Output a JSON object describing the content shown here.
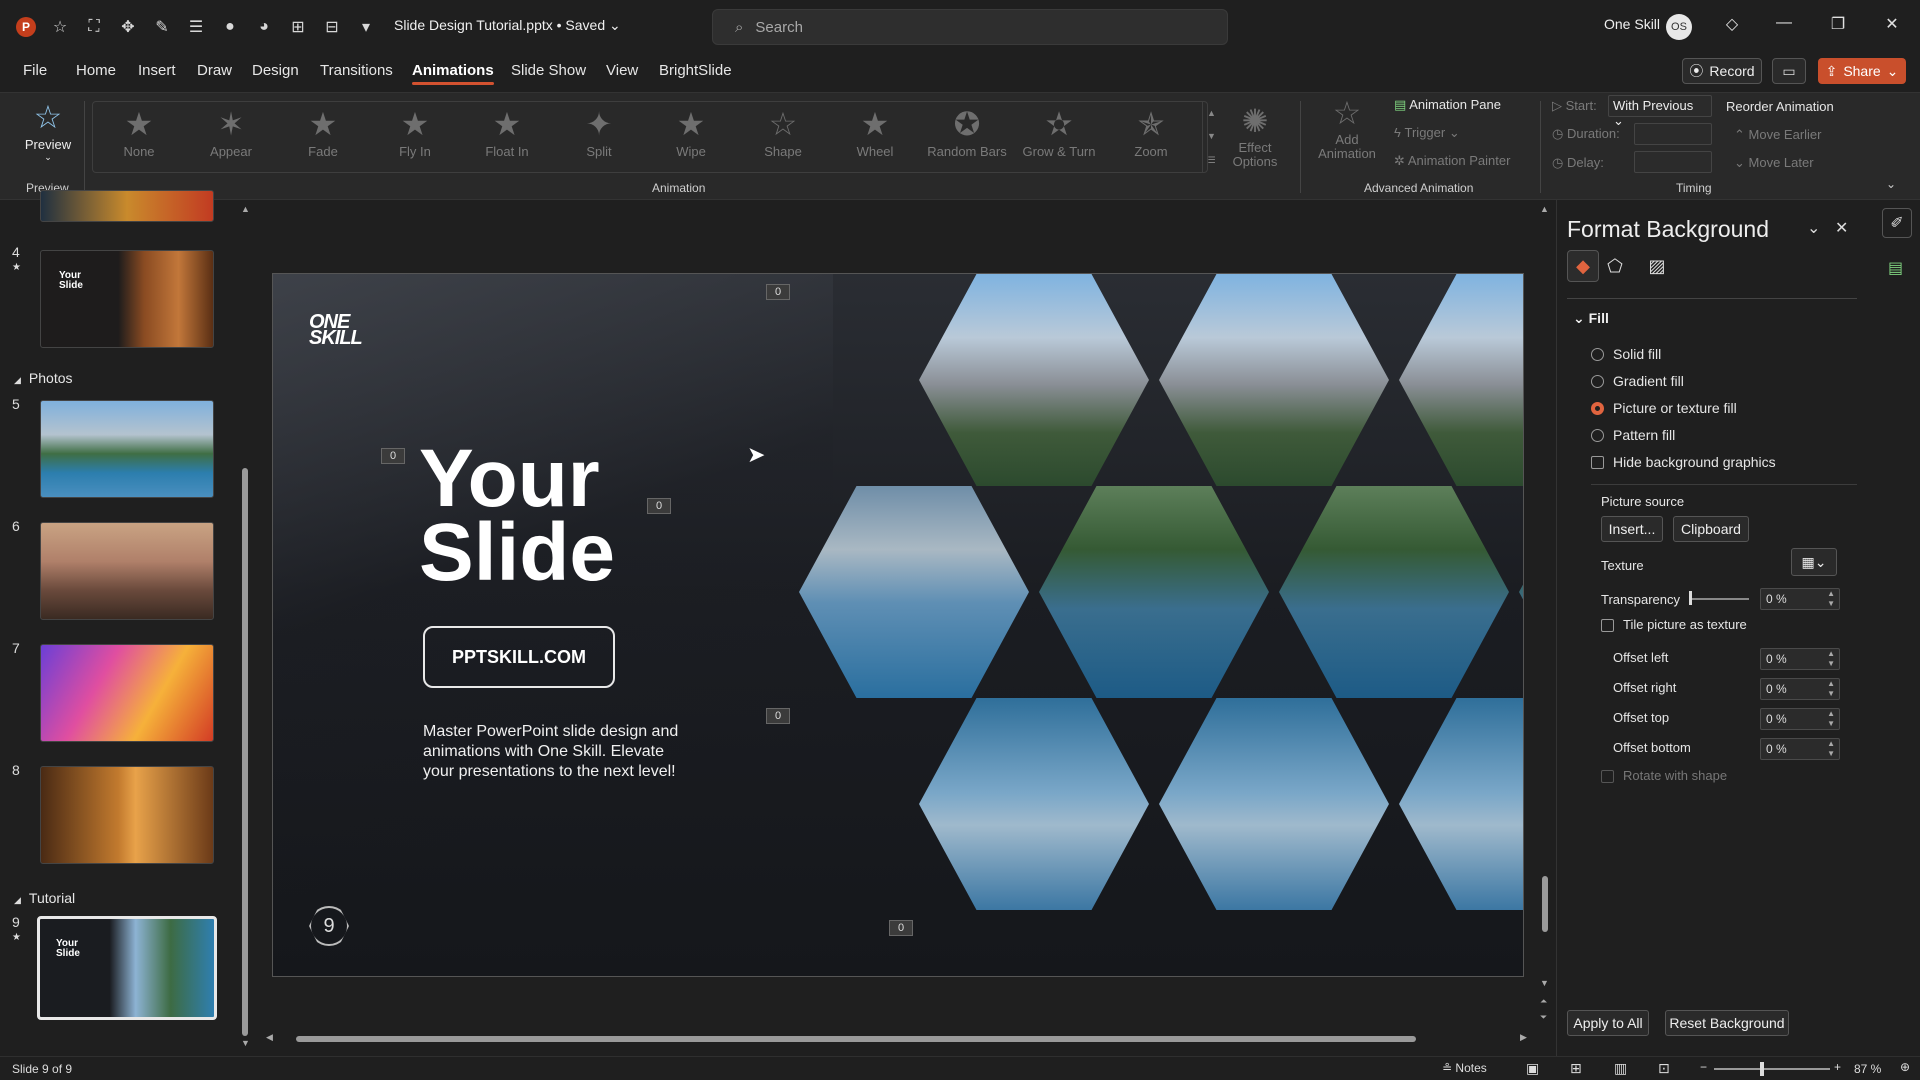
{
  "titlebar": {
    "doc_title": "Slide Design Tutorial.pptx • Saved",
    "search_placeholder": "Search",
    "user_name": "One Skill",
    "avatar_initials": "OS"
  },
  "tabs": [
    "File",
    "Home",
    "Insert",
    "Draw",
    "Design",
    "Transitions",
    "Animations",
    "Slide Show",
    "View",
    "BrightSlide"
  ],
  "active_tab": "Animations",
  "actions": {
    "record": "Record",
    "share": "Share"
  },
  "ribbon": {
    "preview": {
      "label": "Preview",
      "group": "Preview"
    },
    "animation_group": "Animation",
    "animations": [
      "None",
      "Appear",
      "Fade",
      "Fly In",
      "Float In",
      "Split",
      "Wipe",
      "Shape",
      "Wheel",
      "Random Bars",
      "Grow & Turn",
      "Zoom"
    ],
    "effect_options": [
      "Effect",
      "Options"
    ],
    "add_animation": [
      "Add",
      "Animation"
    ],
    "advanced": {
      "group": "Advanced Animation",
      "animation_pane": "Animation Pane",
      "trigger": "Trigger",
      "animation_painter": "Animation Painter"
    },
    "timing": {
      "group": "Timing",
      "start_label": "Start:",
      "start_value": "With Previous",
      "duration_label": "Duration:",
      "delay_label": "Delay:",
      "reorder": "Reorder Animation",
      "move_earlier": "Move Earlier",
      "move_later": "Move Later"
    }
  },
  "slides_pane": {
    "sections": {
      "photos": "Photos",
      "tutorial": "Tutorial"
    },
    "slide_numbers": [
      "4",
      "5",
      "6",
      "7",
      "8",
      "9"
    ]
  },
  "slide": {
    "logo_line1": "ONE",
    "logo_line2": "SKILL",
    "title_line1": "Your",
    "title_line2": "Slide",
    "button": "PPTSKILL.COM",
    "description": "Master PowerPoint slide design and animations with One Skill. Elevate your presentations to the next level!",
    "number": "9",
    "anim_tag": "0"
  },
  "thumb_text": {
    "line1": "Your",
    "line2": "Slide"
  },
  "format_background": {
    "title": "Format Background",
    "section": "Fill",
    "options": [
      "Solid fill",
      "Gradient fill",
      "Picture or texture fill",
      "Pattern fill"
    ],
    "selected_option": "Picture or texture fill",
    "hide_bg": "Hide background graphics",
    "picture_source": "Picture source",
    "insert": "Insert...",
    "clipboard": "Clipboard",
    "texture": "Texture",
    "transparency": "Transparency",
    "transparency_value": "0 %",
    "tile": "Tile picture as texture",
    "offset_left": "Offset left",
    "offset_right": "Offset right",
    "offset_top": "Offset top",
    "offset_bottom": "Offset bottom",
    "offset_value": "0 %",
    "rotate": "Rotate with shape",
    "apply_all": "Apply to All",
    "reset": "Reset Background"
  },
  "statusbar": {
    "slide_info": "Slide 9 of 9",
    "notes": "Notes",
    "zoom": "87 %"
  },
  "colors": {
    "accent": "#d35230",
    "share": "#c94f2c",
    "radio_on": "#e0643f"
  }
}
